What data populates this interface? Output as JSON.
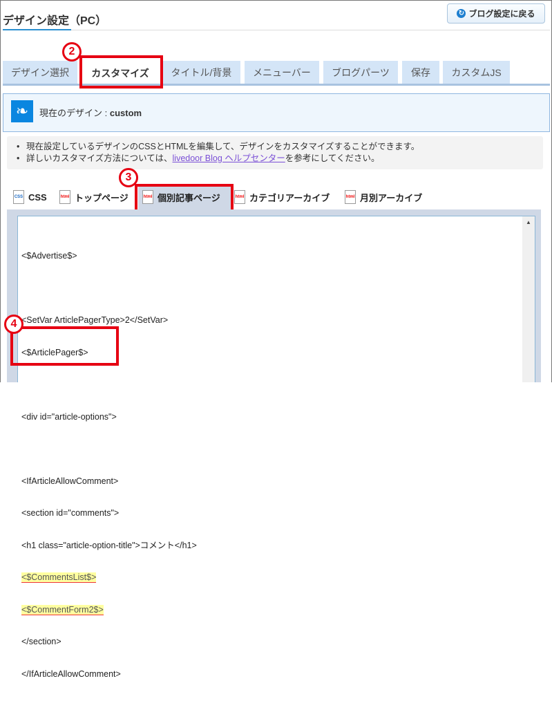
{
  "header": {
    "title": "デザイン設定（PC）",
    "back_button": "ブログ設定に戻る",
    "back_icon": "return-arrow-icon"
  },
  "tabs": [
    {
      "label": "デザイン選択",
      "active": false
    },
    {
      "label": "カスタマイズ",
      "active": true
    },
    {
      "label": "タイトル/背景",
      "active": false
    },
    {
      "label": "メニューバー",
      "active": false
    },
    {
      "label": "ブログパーツ",
      "active": false
    },
    {
      "label": "保存",
      "active": false
    },
    {
      "label": "カスタムJS",
      "active": false
    }
  ],
  "current_design": {
    "label": "現在のデザイン : ",
    "value": "custom",
    "icon": "feather-icon"
  },
  "info": {
    "line1": "現在設定しているデザインのCSSとHTMLを編集して、デザインをカスタマイズすることができます。",
    "line2_prefix": "詳しいカスタマイズ方法については、",
    "line2_link": "livedoor Blog ヘルプセンター",
    "line2_suffix": "を参考にしてください。"
  },
  "file_tabs": [
    {
      "label": "CSS",
      "icon": "css-file-icon",
      "icon_text": "CSS"
    },
    {
      "label": "トップページ",
      "icon": "html-file-icon",
      "icon_text": "html"
    },
    {
      "label": "個別記事ページ",
      "icon": "html-file-icon",
      "icon_text": "html",
      "active": true
    },
    {
      "label": "カテゴリアーカイブ",
      "icon": "html-file-icon",
      "icon_text": "html"
    },
    {
      "label": "月別アーカイブ",
      "icon": "html-file-icon",
      "icon_text": "html"
    }
  ],
  "code_lines": [
    "<$Advertise$>",
    "",
    "<SetVar ArticlePagerType>2</SetVar>",
    "<$ArticlePager$>",
    "",
    "<div id=\"article-options\">",
    "",
    "<IfArticleAllowComment>",
    "<section id=\"comments\">",
    "<h1 class=\"article-option-title\">コメント</h1>",
    "<$CommentsList$>",
    "<$CommentForm2$>",
    "</section>",
    "</IfArticleAllowComment>"
  ],
  "annotations": {
    "step2": "2",
    "step3": "3",
    "step4": "4",
    "color": "#e60012"
  },
  "colors": {
    "accent": "#0a86e0",
    "tab_bg": "#d4e5f7",
    "highlight": "#ffffa0"
  }
}
